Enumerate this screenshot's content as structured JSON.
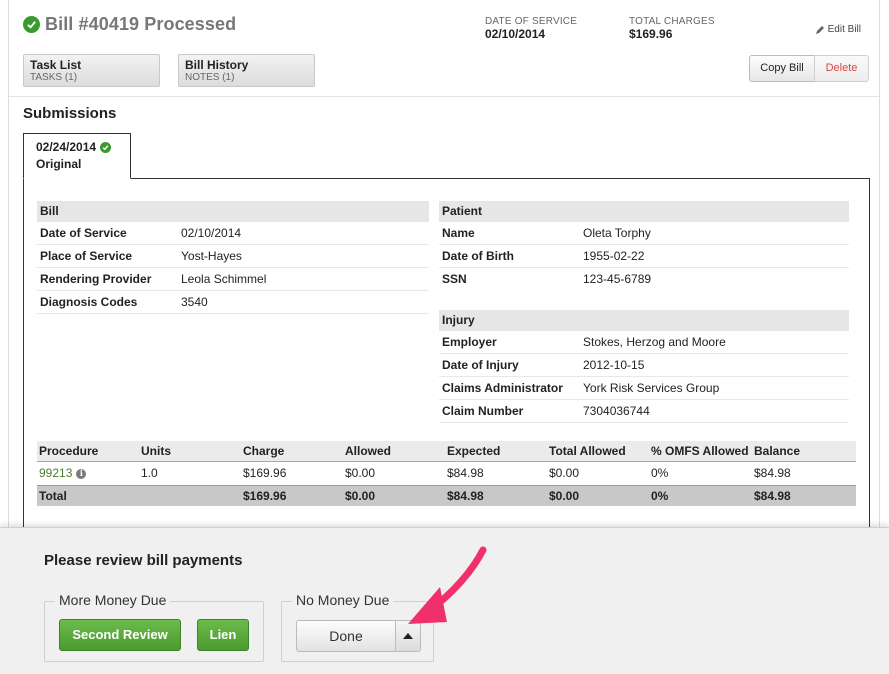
{
  "header": {
    "title": "Bill #40419 Processed",
    "date_of_service_label": "DATE OF SERVICE",
    "date_of_service": "02/10/2014",
    "total_charges_label": "TOTAL CHARGES",
    "total_charges": "$169.96",
    "edit_label": "Edit Bill"
  },
  "tabs": [
    {
      "title": "Task List",
      "sub": "TASKS (1)"
    },
    {
      "title": "Bill History",
      "sub": "NOTES (1)"
    }
  ],
  "actions": {
    "copy": "Copy Bill",
    "delete": "Delete"
  },
  "submissions": {
    "title": "Submissions",
    "tab_date": "02/24/2014",
    "tab_label": "Original"
  },
  "bill": {
    "heading": "Bill",
    "rows": [
      {
        "k": "Date of Service",
        "v": "02/10/2014"
      },
      {
        "k": "Place of Service",
        "v": "Yost-Hayes"
      },
      {
        "k": "Rendering Provider",
        "v": "Leola Schimmel"
      },
      {
        "k": "Diagnosis Codes",
        "v": "3540"
      }
    ]
  },
  "patient": {
    "heading": "Patient",
    "rows": [
      {
        "k": "Name",
        "v": "Oleta Torphy"
      },
      {
        "k": "Date of Birth",
        "v": "1955-02-22"
      },
      {
        "k": "SSN",
        "v": "123-45-6789"
      }
    ]
  },
  "injury": {
    "heading": "Injury",
    "rows": [
      {
        "k": "Employer",
        "v": "Stokes, Herzog and Moore"
      },
      {
        "k": "Date of Injury",
        "v": "2012-10-15"
      },
      {
        "k": "Claims Administrator",
        "v": "York Risk Services Group"
      },
      {
        "k": "Claim Number",
        "v": "7304036744"
      }
    ]
  },
  "procedures": {
    "headers": [
      "Procedure",
      "Units",
      "Charge",
      "Allowed",
      "Expected",
      "Total Allowed",
      "% OMFS Allowed",
      "Balance"
    ],
    "rows": [
      [
        "99213",
        "1.0",
        "$169.96",
        "$0.00",
        "$84.98",
        "$0.00",
        "0%",
        "$84.98"
      ]
    ],
    "total": [
      "Total",
      "",
      "$169.96",
      "$0.00",
      "$84.98",
      "$0.00",
      "0%",
      "$84.98"
    ]
  },
  "review": {
    "title": "Please review bill payments",
    "more_label": "More Money Due",
    "second_review": "Second Review",
    "lien": "Lien",
    "no_label": "No Money Due",
    "done": "Done"
  },
  "colors": {
    "success": "#3a9a2f",
    "green_button": "#5aaa3c",
    "delete_text": "#dd4444",
    "annotation_arrow": "#f0306a"
  }
}
